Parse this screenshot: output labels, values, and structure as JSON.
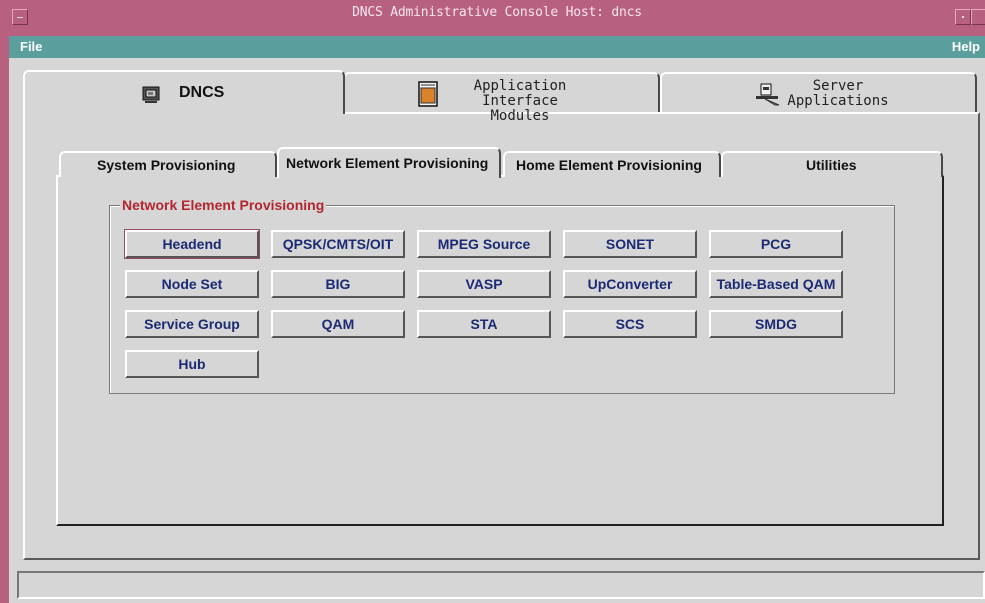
{
  "window": {
    "title": "DNCS Administrative Console    Host: dncs"
  },
  "menubar": {
    "file_label": "File",
    "help_label": "Help"
  },
  "main_tabs": [
    {
      "label": "DNCS",
      "icon": "monitor-icon",
      "active": true
    },
    {
      "line1": "Application",
      "line2": "Interface Modules",
      "icon": "document-icon",
      "active": false
    },
    {
      "line1": "Server",
      "line2": "Applications",
      "icon": "server-icon",
      "active": false
    }
  ],
  "sub_tabs": [
    {
      "label": "System Provisioning",
      "active": false
    },
    {
      "label": "Network Element Provisioning",
      "active": true
    },
    {
      "label": "Home Element Provisioning",
      "active": false
    },
    {
      "label": "Utilities",
      "active": false
    }
  ],
  "group": {
    "title": "Network Element Provisioning",
    "buttons": [
      "Headend",
      "QPSK/CMTS/OIT",
      "MPEG Source",
      "SONET",
      "PCG",
      "Node Set",
      "BIG",
      "VASP",
      "UpConverter",
      "Table-Based QAM",
      "Service Group",
      "QAM",
      "STA",
      "SCS",
      "SMDG",
      "Hub"
    ]
  },
  "status": {
    "text": ""
  },
  "colors": {
    "titlebar": "#b8607f",
    "menubar": "#5a9e9e",
    "legend": "#b3262e",
    "button_text": "#1b2a73"
  }
}
